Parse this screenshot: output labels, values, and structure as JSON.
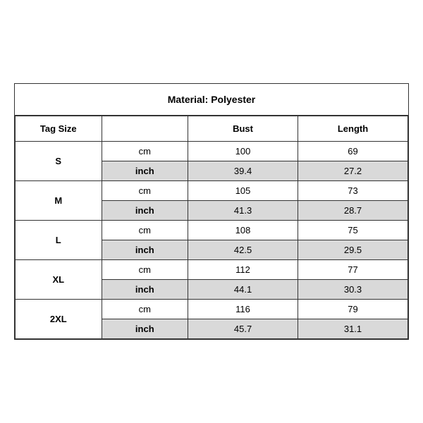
{
  "title": "Material: Polyester",
  "headers": {
    "tag_size": "Tag Size",
    "bust": "Bust",
    "length": "Length"
  },
  "sizes": [
    {
      "tag": "S",
      "rows": [
        {
          "unit": "cm",
          "bust": "100",
          "length": "69",
          "shaded": false
        },
        {
          "unit": "inch",
          "bust": "39.4",
          "length": "27.2",
          "shaded": true
        }
      ]
    },
    {
      "tag": "M",
      "rows": [
        {
          "unit": "cm",
          "bust": "105",
          "length": "73",
          "shaded": false
        },
        {
          "unit": "inch",
          "bust": "41.3",
          "length": "28.7",
          "shaded": true
        }
      ]
    },
    {
      "tag": "L",
      "rows": [
        {
          "unit": "cm",
          "bust": "108",
          "length": "75",
          "shaded": false
        },
        {
          "unit": "inch",
          "bust": "42.5",
          "length": "29.5",
          "shaded": true
        }
      ]
    },
    {
      "tag": "XL",
      "rows": [
        {
          "unit": "cm",
          "bust": "112",
          "length": "77",
          "shaded": false
        },
        {
          "unit": "inch",
          "bust": "44.1",
          "length": "30.3",
          "shaded": true
        }
      ]
    },
    {
      "tag": "2XL",
      "rows": [
        {
          "unit": "cm",
          "bust": "116",
          "length": "79",
          "shaded": false
        },
        {
          "unit": "inch",
          "bust": "45.7",
          "length": "31.1",
          "shaded": true
        }
      ]
    }
  ]
}
